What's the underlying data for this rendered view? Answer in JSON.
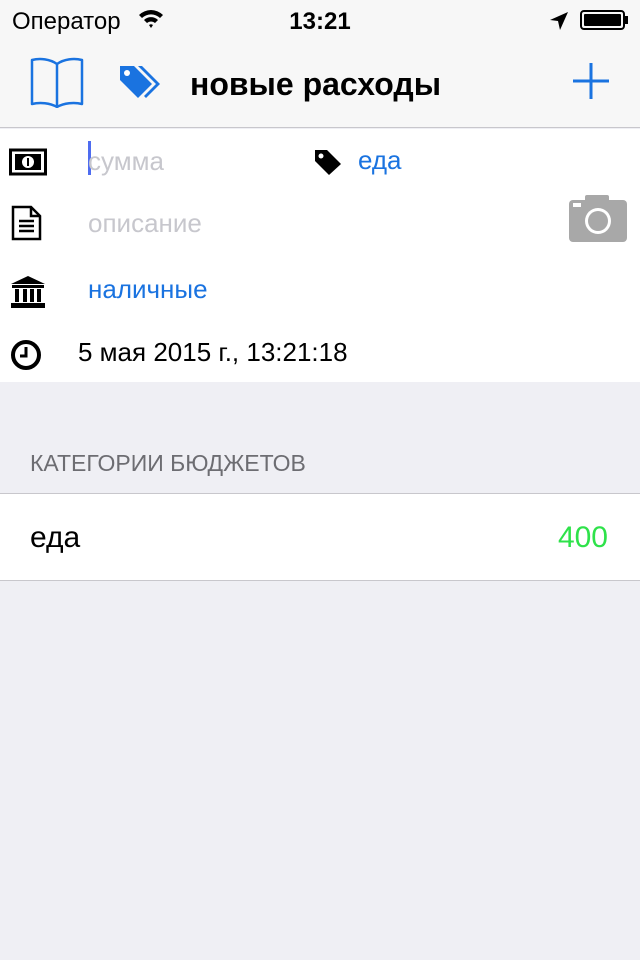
{
  "status_bar": {
    "carrier": "Оператор",
    "time": "13:21",
    "icons": [
      "wifi-icon",
      "location-arrow-icon",
      "battery-icon"
    ]
  },
  "nav": {
    "title": "новые расходы",
    "icons": [
      "book-icon",
      "tags-icon",
      "plus-icon"
    ],
    "accent_color": "#1a73e0"
  },
  "form": {
    "amount": {
      "value": "",
      "placeholder": "сумма"
    },
    "category": {
      "label": "еда"
    },
    "description": {
      "value": "",
      "placeholder": "описание"
    },
    "account": {
      "label": "наличные"
    },
    "datetime": "5 мая 2015 г., 13:21:18",
    "icons": [
      "money-icon",
      "document-icon",
      "bank-icon",
      "clock-icon",
      "tag-icon",
      "camera-icon"
    ]
  },
  "budgets": {
    "header": "КАТЕГОРИИ БЮДЖЕТОВ",
    "items": [
      {
        "name": "еда",
        "value": "400",
        "value_color": "#2ee24a"
      }
    ]
  }
}
